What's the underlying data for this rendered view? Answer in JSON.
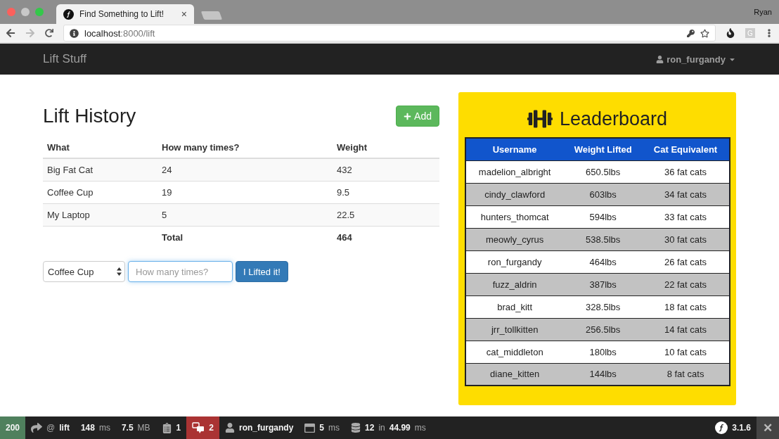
{
  "browser": {
    "tab": {
      "title": "Find Something to Lift!",
      "close": "×"
    },
    "profile": "Ryan",
    "address": {
      "host": "localhost",
      "path": ":8000/lift"
    },
    "extension_letter": "G"
  },
  "navbar": {
    "brand": "Lift Stuff",
    "user": "ron_furgandy"
  },
  "lift_history": {
    "title": "Lift History",
    "add_button": "Add",
    "columns": [
      "What",
      "How many times?",
      "Weight"
    ],
    "rows": [
      [
        "Big Fat Cat",
        "24",
        "432"
      ],
      [
        "Coffee Cup",
        "19",
        "9.5"
      ],
      [
        "My Laptop",
        "5",
        "22.5"
      ]
    ],
    "total": {
      "label": "Total",
      "value": "464"
    }
  },
  "form": {
    "item_select": "Coffee Cup",
    "reps": {
      "placeholder": "How many times?"
    },
    "submit": "I Lifted it!"
  },
  "leaderboard": {
    "title": "Leaderboard",
    "columns": [
      "Username",
      "Weight Lifted",
      "Cat Equivalent"
    ],
    "rows": [
      [
        "madelion_albright",
        "650.5lbs",
        "36 fat cats"
      ],
      [
        "cindy_clawford",
        "603lbs",
        "34 fat cats"
      ],
      [
        "hunters_thomcat",
        "594lbs",
        "33 fat cats"
      ],
      [
        "meowly_cyrus",
        "538.5lbs",
        "30 fat cats"
      ],
      [
        "ron_furgandy",
        "464lbs",
        "26 fat cats"
      ],
      [
        "fuzz_aldrin",
        "387lbs",
        "22 fat cats"
      ],
      [
        "brad_kitt",
        "328.5lbs",
        "18 fat cats"
      ],
      [
        "jrr_tollkitten",
        "256.5lbs",
        "14 fat cats"
      ],
      [
        "cat_middleton",
        "180lbs",
        "10 fat cats"
      ],
      [
        "diane_kitten",
        "144lbs",
        "8 fat cats"
      ]
    ]
  },
  "debug_toolbar": {
    "items": [
      {
        "kind": "status",
        "parts": [
          {
            "text": "200",
            "muted": false
          }
        ]
      },
      {
        "kind": "route",
        "parts": [
          {
            "text": "@",
            "muted": true
          },
          {
            "text": "lift",
            "muted": false
          }
        ]
      },
      {
        "kind": "plain",
        "parts": [
          {
            "text": "148",
            "muted": false
          },
          {
            "text": "ms",
            "muted": true
          }
        ]
      },
      {
        "kind": "plain",
        "parts": [
          {
            "text": "7.5",
            "muted": false
          },
          {
            "text": "MB",
            "muted": true
          }
        ]
      },
      {
        "kind": "forms",
        "parts": [
          {
            "text": "1",
            "muted": false
          }
        ]
      },
      {
        "kind": "translation",
        "parts": [
          {
            "text": "2",
            "muted": false
          }
        ]
      },
      {
        "kind": "user",
        "parts": [
          {
            "text": "ron_furgandy",
            "muted": false
          }
        ]
      },
      {
        "kind": "layout",
        "parts": [
          {
            "text": "5",
            "muted": false
          },
          {
            "text": "ms",
            "muted": true
          }
        ]
      },
      {
        "kind": "database",
        "parts": [
          {
            "text": "12",
            "muted": false
          },
          {
            "text": "in",
            "muted": true
          },
          {
            "text": "44.99",
            "muted": false
          },
          {
            "text": "ms",
            "muted": true
          }
        ]
      }
    ],
    "version": "3.1.6",
    "close": "✕"
  }
}
